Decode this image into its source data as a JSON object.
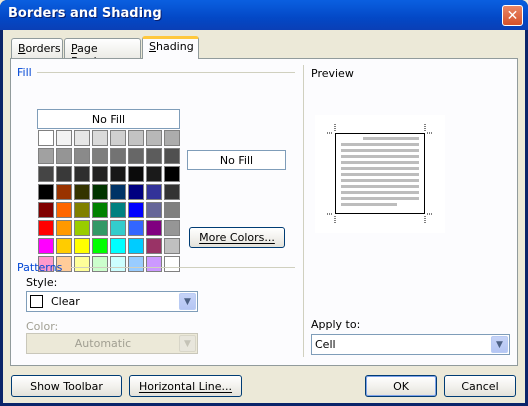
{
  "window": {
    "title": "Borders and Shading",
    "close_glyph": "✕"
  },
  "tabs": [
    {
      "label": "Borders",
      "access_key": "B",
      "rest": "orders",
      "active": false
    },
    {
      "label": "Page Border",
      "access_key": "P",
      "rest": "age Border",
      "active": false
    },
    {
      "label": "Shading",
      "access_key": "S",
      "rest": "hading",
      "active": true
    }
  ],
  "fill": {
    "label": "Fill",
    "no_fill_label": "No Fill",
    "selected_label": "No Fill",
    "more_colors_label": "More Colors...",
    "swatches": [
      [
        "#FFFFFF",
        "#F2F2F2",
        "#E6E6E6",
        "#DADADA",
        "#CFCFCF",
        "#C3C3C3",
        "#B8B8B8",
        "#ACACAC"
      ],
      [
        "#A1A1A1",
        "#959595",
        "#8A8A8A",
        "#7E7E7E",
        "#737373",
        "#676767",
        "#5C5C5C",
        "#505050"
      ],
      [
        "#454545",
        "#393939",
        "#2E2E2E",
        "#222222",
        "#171717",
        "#0B0B0B",
        "#1A1A1A",
        "#000000"
      ],
      [
        "#000000",
        "#993300",
        "#333300",
        "#003300",
        "#003366",
        "#000080",
        "#333399",
        "#333333"
      ],
      [
        "#800000",
        "#FF6600",
        "#808000",
        "#008000",
        "#008080",
        "#0000FF",
        "#666699",
        "#808080"
      ],
      [
        "#FF0000",
        "#FF9900",
        "#99CC00",
        "#339966",
        "#33CCCC",
        "#3366FF",
        "#800080",
        "#969696"
      ],
      [
        "#FF00FF",
        "#FFCC00",
        "#FFFF00",
        "#00FF00",
        "#00FFFF",
        "#00CCFF",
        "#993366",
        "#C0C0C0"
      ],
      [
        "#FF99CC",
        "#FFCC99",
        "#FFFF99",
        "#CCFFCC",
        "#CCFFFF",
        "#99CCFF",
        "#CC99FF",
        "#FFFFFF"
      ]
    ]
  },
  "patterns": {
    "label": "Patterns",
    "style_label": "Style:",
    "style_value": "Clear",
    "color_label": "Color:",
    "color_value": "Automatic"
  },
  "preview": {
    "label": "Preview"
  },
  "apply_to": {
    "label": "Apply to:",
    "value": "Cell"
  },
  "footer": {
    "show_toolbar": "Show Toolbar",
    "horizontal_line": "Horizontal Line...",
    "ok": "OK",
    "cancel": "Cancel"
  }
}
